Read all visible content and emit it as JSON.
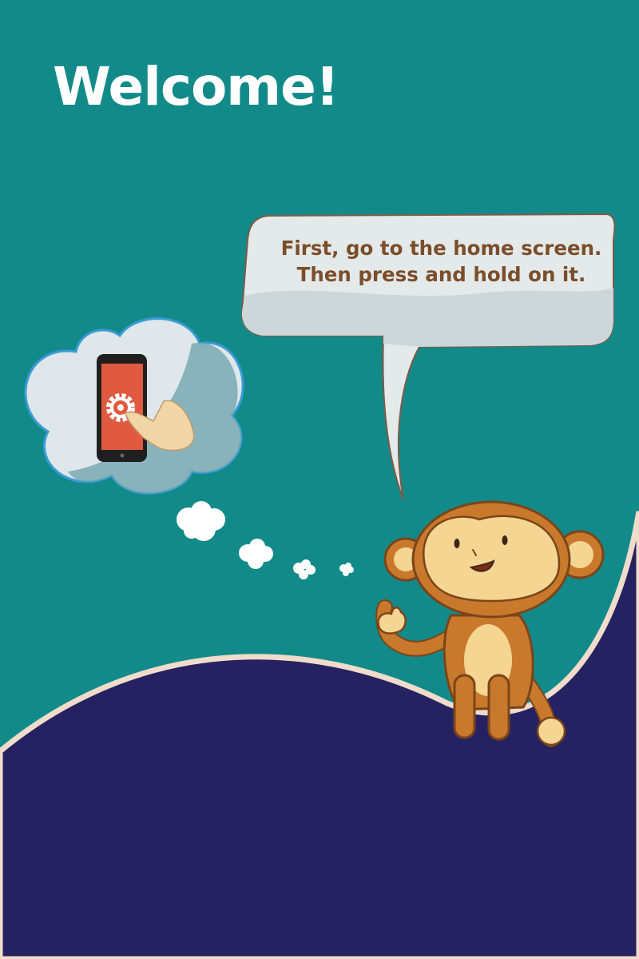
{
  "title": "Welcome!",
  "speech": {
    "line1": "First, go to the home screen.",
    "line2": "Then press and hold on it."
  },
  "colors": {
    "background": "#138a8a",
    "ground": "#262261",
    "ground_edge": "#f1dccb",
    "text": "#ffffff",
    "speech_text": "#7b4e2a",
    "phone_screen": "#e05a41",
    "monkey_fur": "#c9792c",
    "monkey_face": "#f4d592"
  },
  "icons": {
    "phone": "phone-icon",
    "gear": "gear-icon",
    "hand": "pointing-hand-icon"
  }
}
